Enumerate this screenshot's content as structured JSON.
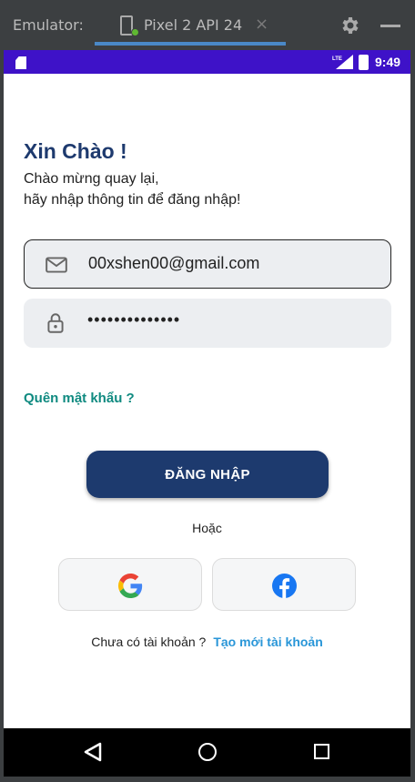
{
  "emulator": {
    "title": "Emulator:",
    "tab_label": "Pixel 2 API 24",
    "close_glyph": "×"
  },
  "status_bar": {
    "network": "LTE",
    "time": "9:49"
  },
  "login": {
    "title": "Xin Chào !",
    "subtitle_line1": "Chào mừng quay lại,",
    "subtitle_line2": "hãy nhập thông tin để đăng nhập!",
    "email_value": "00xshen00@gmail.com",
    "password_value": "••••••••••••••",
    "forgot_label": "Quên mật khẩu ?",
    "login_button": "ĐĂNG NHẬP",
    "or_label": "Hoặc",
    "no_account_text": "Chưa có tài khoản ?",
    "create_account_link": "Tạo mới tài khoản"
  },
  "colors": {
    "accent": "#1d3a6e",
    "status_bar": "#3e12c8",
    "link": "#2996d8",
    "forgot": "#0f8a80"
  },
  "icons": [
    "device-icon",
    "close-icon",
    "gear-icon",
    "minimize-icon",
    "sd-card-icon",
    "lte-signal-icon",
    "battery-icon",
    "mail-icon",
    "lock-icon",
    "google-icon",
    "facebook-icon",
    "back-icon",
    "home-icon",
    "recents-icon"
  ]
}
